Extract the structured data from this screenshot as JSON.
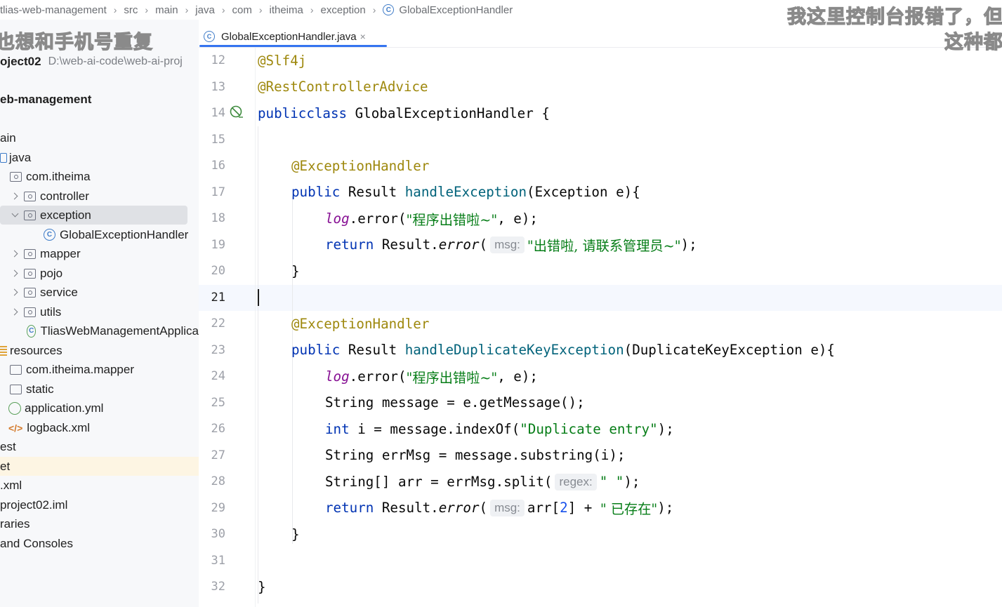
{
  "breadcrumb": {
    "items": [
      "tlias-web-management",
      "src",
      "main",
      "java",
      "com",
      "itheima",
      "exception",
      "GlobalExceptionHandler"
    ]
  },
  "project": {
    "root_name": "oject02",
    "root_path": "D:\\web-ai-code\\web-ai-proj",
    "module": "eb-management",
    "tree": [
      {
        "label": "ain"
      },
      {
        "label": "java"
      },
      {
        "label": "com.itheima"
      },
      {
        "label": "controller"
      },
      {
        "label": "exception"
      },
      {
        "label": "GlobalExceptionHandler"
      },
      {
        "label": "mapper"
      },
      {
        "label": "pojo"
      },
      {
        "label": "service"
      },
      {
        "label": "utils"
      },
      {
        "label": "TliasWebManagementApplica"
      },
      {
        "label": "resources"
      },
      {
        "label": "com.itheima.mapper"
      },
      {
        "label": "static"
      },
      {
        "label": "application.yml"
      },
      {
        "label": "logback.xml"
      },
      {
        "label": "est"
      },
      {
        "label": "et"
      },
      {
        "label": ".xml"
      },
      {
        "label": "project02.iml"
      },
      {
        "label": "raries"
      },
      {
        "label": "and Consoles"
      }
    ]
  },
  "editor": {
    "tab_label": "GlobalExceptionHandler.java",
    "tab_close": "×",
    "line_numbers": [
      "12",
      "13",
      "14",
      "15",
      "16",
      "17",
      "18",
      "19",
      "20",
      "21",
      "22",
      "23",
      "24",
      "25",
      "26",
      "27",
      "28",
      "29",
      "30",
      "31",
      "32"
    ],
    "code": {
      "l12": "@Slf4j",
      "l13": "@RestControllerAdvice",
      "l14_kw1": "public",
      "l14_kw2": "class",
      "l14_rest": " GlobalExceptionHandler {",
      "l16": "@ExceptionHandler",
      "l17_kw": "public",
      "l17_a": " Result ",
      "l17_fn": "handleException",
      "l17_b": "(Exception e){",
      "l18_fld": "log",
      "l18_a": ".error(",
      "l18_str": "\"程序出错啦~\"",
      "l18_b": ", e);",
      "l19_kw": "return",
      "l19_a": " Result.",
      "l19_it": "error",
      "l19_b": "(",
      "l19_hint": "msg:",
      "l19_str": "\"出错啦, 请联系管理员~\"",
      "l19_c": ");",
      "l20": "}",
      "l22": "@ExceptionHandler",
      "l23_kw": "public",
      "l23_a": " Result ",
      "l23_fn": "handleDuplicateKeyException",
      "l23_b": "(DuplicateKeyException e){",
      "l24_fld": "log",
      "l24_a": ".error(",
      "l24_str": "\"程序出错啦~\"",
      "l24_b": ", e);",
      "l25": "String message = e.getMessage();",
      "l26_kw": "int",
      "l26_a": " i = message.indexOf(",
      "l26_str": "\"Duplicate entry\"",
      "l26_b": ");",
      "l27": "String errMsg = message.substring(i);",
      "l28_a": "String[] arr = errMsg.split(",
      "l28_hint": "regex:",
      "l28_str": "\" \"",
      "l28_b": ");",
      "l29_kw": "return",
      "l29_a": " Result.",
      "l29_it": "error",
      "l29_b": "(",
      "l29_hint": "msg:",
      "l29_c": "arr[",
      "l29_num": "2",
      "l29_d": "] + ",
      "l29_str": "\" 已存在\"",
      "l29_e": ");",
      "l30": "}",
      "l32": "}"
    }
  },
  "overlay": {
    "top_right": "我这里控制台报错了，但",
    "top_right_2": "这种都",
    "top_left": "也想和手机号重复"
  },
  "colors": {
    "keyword": "#0033b3",
    "annotation": "#9e880d",
    "method": "#00627a",
    "string": "#067d17",
    "field": "#871094",
    "tab_underline": "#3574f0"
  }
}
